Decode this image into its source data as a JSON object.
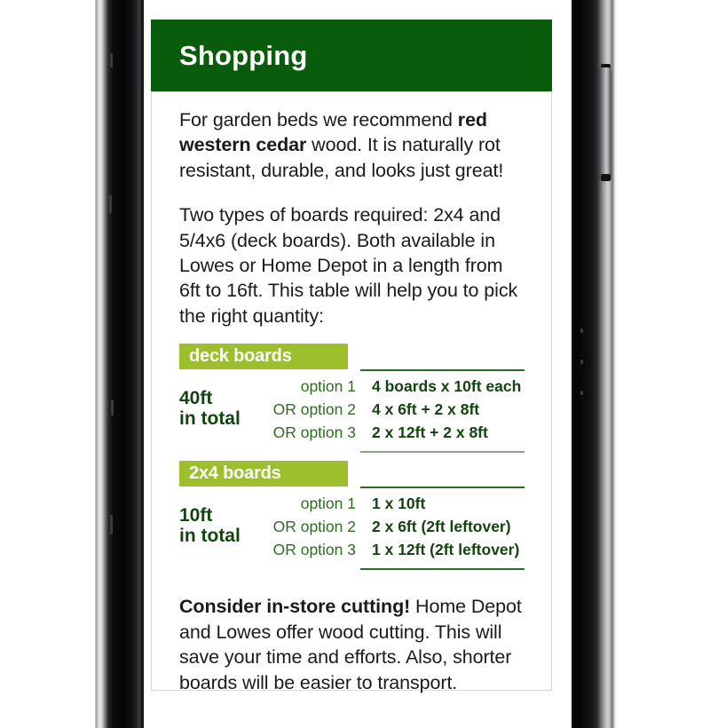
{
  "device": {
    "frame": "smartphone-bezel",
    "bezel_color": "#050505",
    "metal_color": "#c9c9cc"
  },
  "colors": {
    "header_green": "#0a5c0d",
    "label_green": "#9cbf2b",
    "dark_text_green": "#14440f",
    "option_green": "#2f6b23",
    "rule_dark": "#2c6b2a",
    "rule_light": "#8aa67f"
  },
  "header": {
    "title": "Shopping"
  },
  "paragraphs": {
    "intro": {
      "lead": "For garden beds we recommend ",
      "bold": "red western cedar",
      "tail": " wood. It is naturally rot resistant, durable, and looks just great!"
    },
    "boards": "Two types of boards required: 2x4 and 5/4x6 (deck boards). Both available in Lowes or Home Depot in a length from 6ft to 16ft. This table will help you to pick the right quantity:",
    "cutting": {
      "bold": "Consider in-store cutting!",
      "tail": " Home Depot and Lowes offer wood cutting. This will save your time and efforts. Also, shorter boards will be easier to transport."
    }
  },
  "tables": [
    {
      "label": "deck boards",
      "total_amount": "40ft",
      "total_caption": "in total",
      "rows": [
        {
          "option": "option 1",
          "value": "4 boards x 10ft each"
        },
        {
          "option": "OR option 2",
          "value": "4 x 6ft + 2 x 8ft"
        },
        {
          "option": "OR option 3",
          "value": "2 x 12ft + 2 x 8ft"
        }
      ]
    },
    {
      "label": "2x4 boards",
      "total_amount": "10ft",
      "total_caption": "in total",
      "rows": [
        {
          "option": "option 1",
          "value": "1 x 10ft"
        },
        {
          "option": "OR option 2",
          "value": "2 x 6ft (2ft leftover)"
        },
        {
          "option": "OR option 3",
          "value": "1 x 12ft (2ft leftover)"
        }
      ]
    }
  ]
}
